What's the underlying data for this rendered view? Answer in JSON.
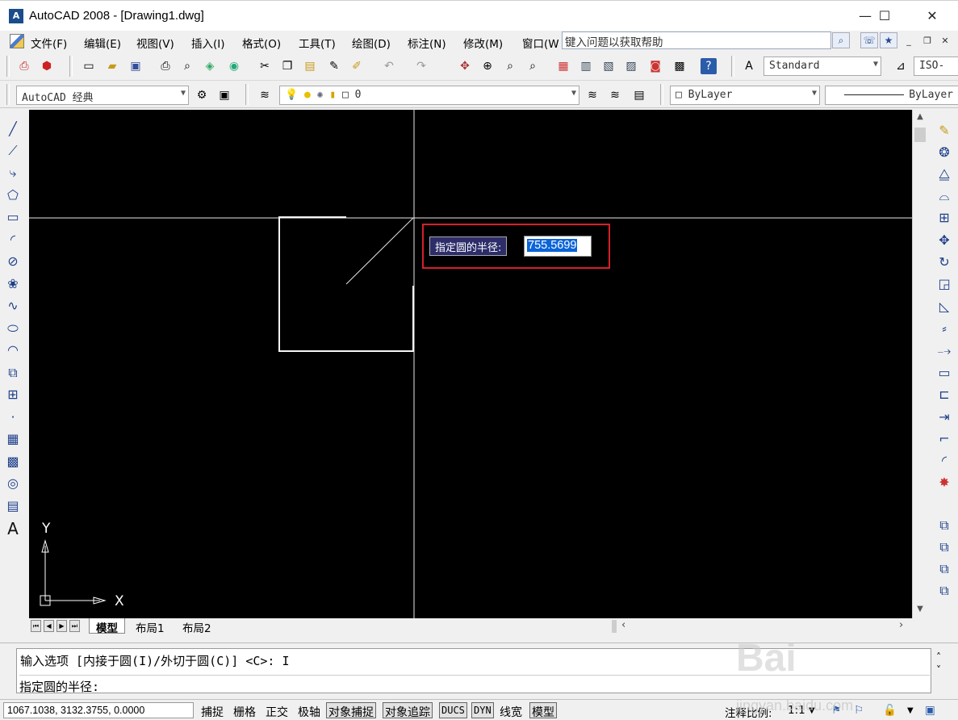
{
  "window": {
    "title": "AutoCAD 2008 - [Drawing1.dwg]",
    "app_icon": "A",
    "minimize": "—",
    "maximize": "☐",
    "close": "✕"
  },
  "menu": {
    "items": [
      "文件(F)",
      "编辑(E)",
      "视图(V)",
      "插入(I)",
      "格式(O)",
      "工具(T)",
      "绘图(D)",
      "标注(N)",
      "修改(M)",
      "窗口(W"
    ],
    "help_placeholder": "键入问题以获取帮助"
  },
  "toolbar": {
    "text_style": "Standard",
    "dim_style": "ISO-",
    "workspace": "AutoCAD 经典",
    "layer": "0",
    "color": "ByLayer",
    "linetype": "ByLayer"
  },
  "dynamic_input": {
    "prompt": "指定圆的半径:",
    "value": "755.5699"
  },
  "tabs": [
    "模型",
    "布局1",
    "布局2"
  ],
  "command": {
    "history_line": "输入选项 [内接于圆(I)/外切于圆(C)] <C>: I",
    "current_line": "指定圆的半径:"
  },
  "status": {
    "coordinates": "1067.1038,   3132.3755, 0.0000",
    "toggles": [
      {
        "label": "捕捉",
        "on": false
      },
      {
        "label": "栅格",
        "on": false
      },
      {
        "label": "正交",
        "on": false
      },
      {
        "label": "极轴",
        "on": false
      },
      {
        "label": "对象捕捉",
        "on": true
      },
      {
        "label": "对象追踪",
        "on": true
      },
      {
        "label": "DUCS",
        "on": true
      },
      {
        "label": "DYN",
        "on": true
      },
      {
        "label": "线宽",
        "on": false
      },
      {
        "label": "模型",
        "on": true
      }
    ],
    "annotation_scale_label": "注释比例:",
    "annotation_scale": "1:1"
  },
  "ucs": {
    "x_label": "X",
    "y_label": "Y"
  },
  "watermark": {
    "brand": "Bai",
    "site": "jingyan.baidu.com"
  },
  "colors": {
    "canvas": "#000000",
    "highlight": "#d6202a",
    "selection": "#0a64d8",
    "tooltip_bg": "#2d2d6a"
  }
}
